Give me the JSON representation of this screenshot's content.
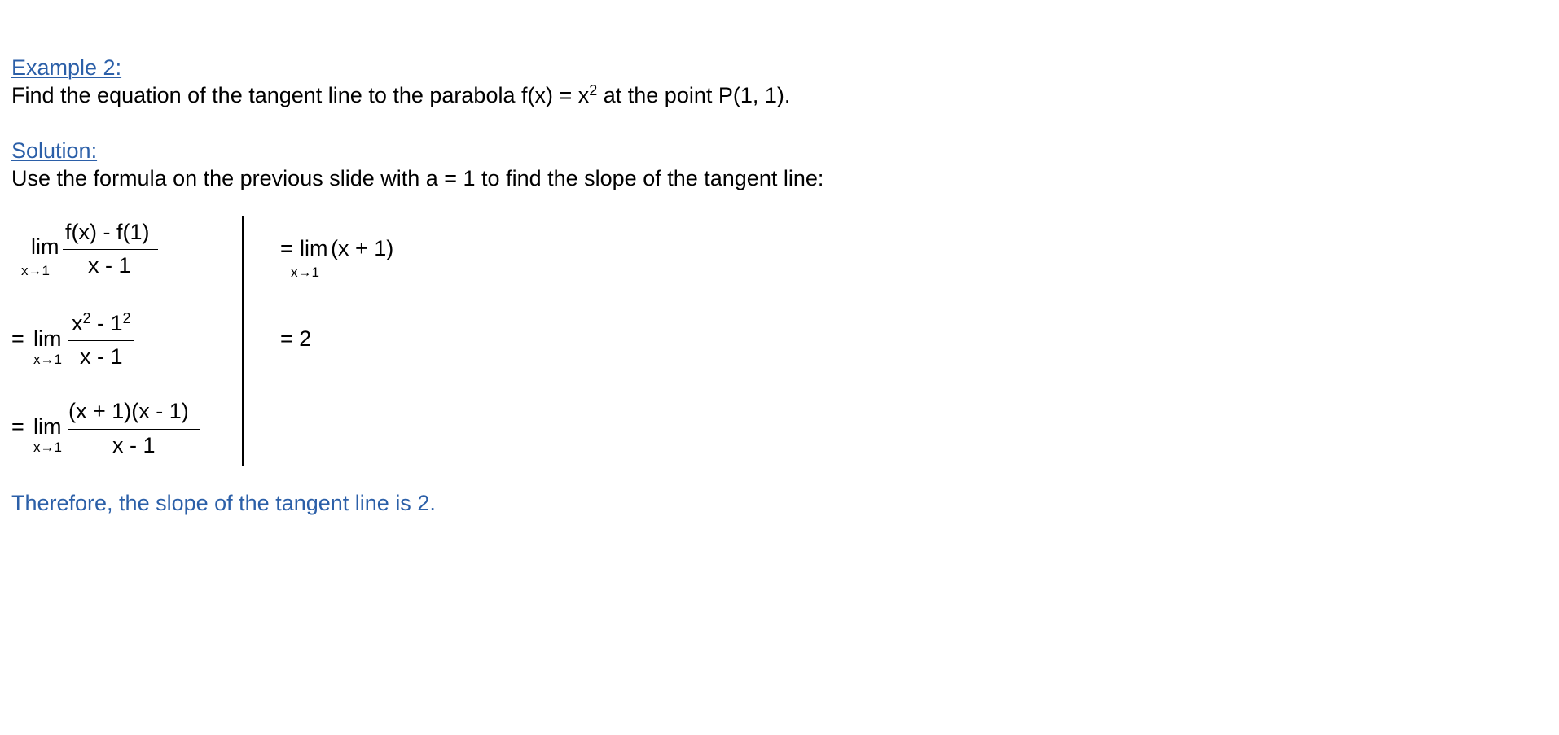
{
  "example": {
    "heading": "Example 2:",
    "problem_before": "Find the equation of the tangent line to the parabola f(x) = x",
    "problem_exp": "2",
    "problem_after": " at the point P(1, 1)."
  },
  "solution": {
    "heading": "Solution:",
    "intro": "Use the formula on the previous slide with a = 1 to find the slope of the tangent line:"
  },
  "steps": {
    "lim": "lim",
    "limit_sub": "x→1",
    "equals": "=",
    "step1": {
      "numerator": "f(x) - f(1)",
      "denominator": "x - 1"
    },
    "step2": {
      "num_x": "x",
      "num_exp1": "2",
      "num_mid": " - 1",
      "num_exp2": "2",
      "denominator": "x - 1"
    },
    "step3": {
      "numerator": "(x + 1)(x - 1)",
      "denominator": "x - 1"
    },
    "step4": {
      "expr": "(x + 1)"
    },
    "step5": {
      "result": "= 2"
    }
  },
  "conclusion": "Therefore, the slope of the tangent line is 2."
}
